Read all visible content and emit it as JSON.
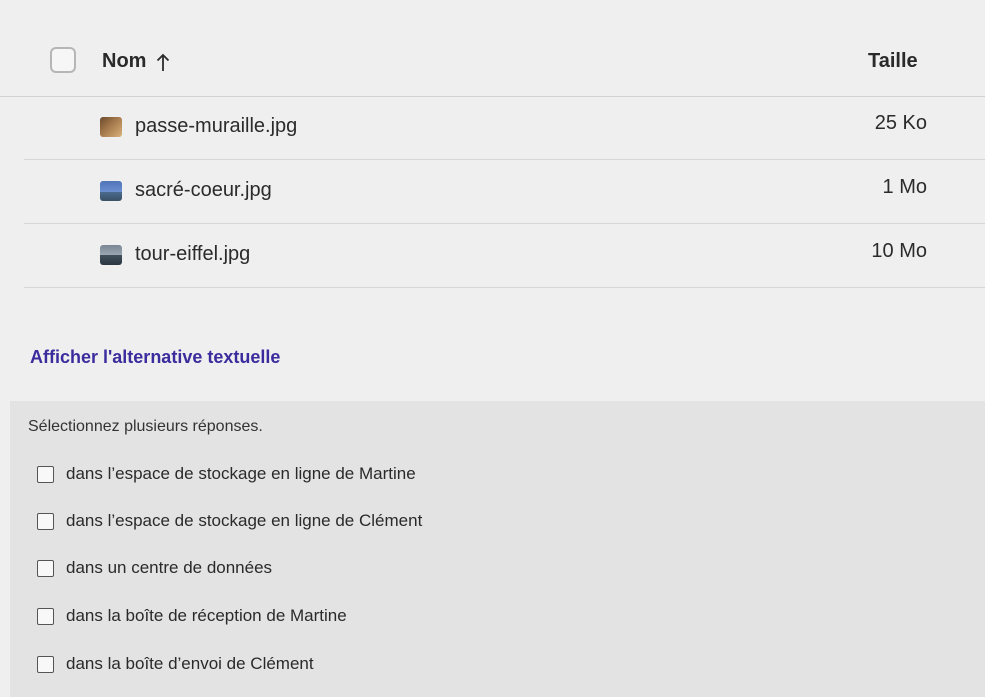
{
  "table": {
    "header": {
      "name_label": "Nom",
      "sort_icon": "arrow-up-icon",
      "size_label": "Taille"
    },
    "files": [
      {
        "name": "passe-muraille.jpg",
        "size": "25 Ko",
        "thumbnail": "image-thumbnail-icon"
      },
      {
        "name": "sacré-coeur.jpg",
        "size": "1 Mo",
        "thumbnail": "image-thumbnail-icon"
      },
      {
        "name": "tour-eiffel.jpg",
        "size": "10 Mo",
        "thumbnail": "image-thumbnail-icon"
      }
    ]
  },
  "alt_text_link": "Afficher l'alternative textuelle",
  "question": {
    "instructions": "Sélectionnez plusieurs réponses.",
    "options": [
      {
        "label": "dans l’espace de stockage en ligne de Martine",
        "checked": false
      },
      {
        "label": "dans l’espace de stockage en ligne de Clément",
        "checked": false
      },
      {
        "label": "dans un centre de données",
        "checked": false
      },
      {
        "label": "dans la boîte de réception de Martine",
        "checked": false
      },
      {
        "label": "dans la boîte d’envoi de Clément",
        "checked": false
      }
    ]
  },
  "colors": {
    "link": "#3b2c9e",
    "panel_background": "#e3e3e3",
    "page_background": "#efefef"
  }
}
